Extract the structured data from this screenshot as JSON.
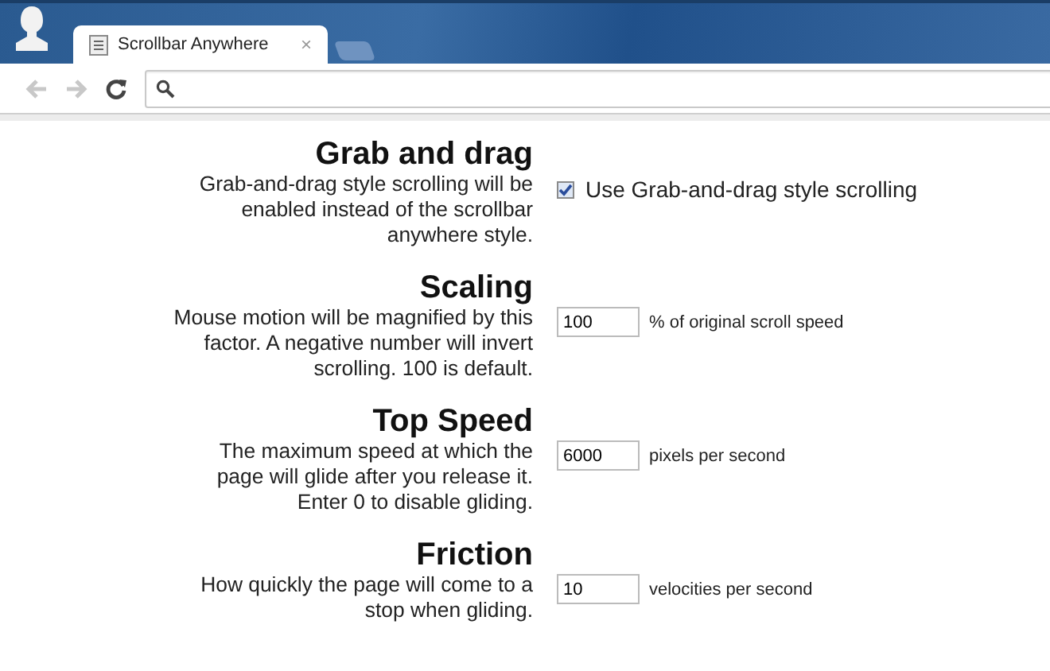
{
  "tab": {
    "title": "Scrollbar Anywhere",
    "close": "×",
    "selected": true
  },
  "settings": [
    {
      "kind": "checkbox",
      "heading": "Grab and drag",
      "description": "Grab-and-drag style scrolling will be enabled instead of the scrollbar anywhere style.",
      "label": "Use Grab-and-drag style scrolling",
      "checked": true
    },
    {
      "kind": "number",
      "heading": "Scaling",
      "description": "Mouse motion will be magnified by this factor. A negative number will invert scrolling. 100 is default.",
      "value": "100",
      "unit": "% of original scroll speed"
    },
    {
      "kind": "number",
      "heading": "Top Speed",
      "description": "The maximum speed at which the page will glide after you release it. Enter 0 to disable gliding.",
      "value": "6000",
      "unit": "pixels per second"
    },
    {
      "kind": "number",
      "heading": "Friction",
      "description": "How quickly the page will come to a stop when gliding.",
      "value": "10",
      "unit": "velocities per second"
    }
  ]
}
